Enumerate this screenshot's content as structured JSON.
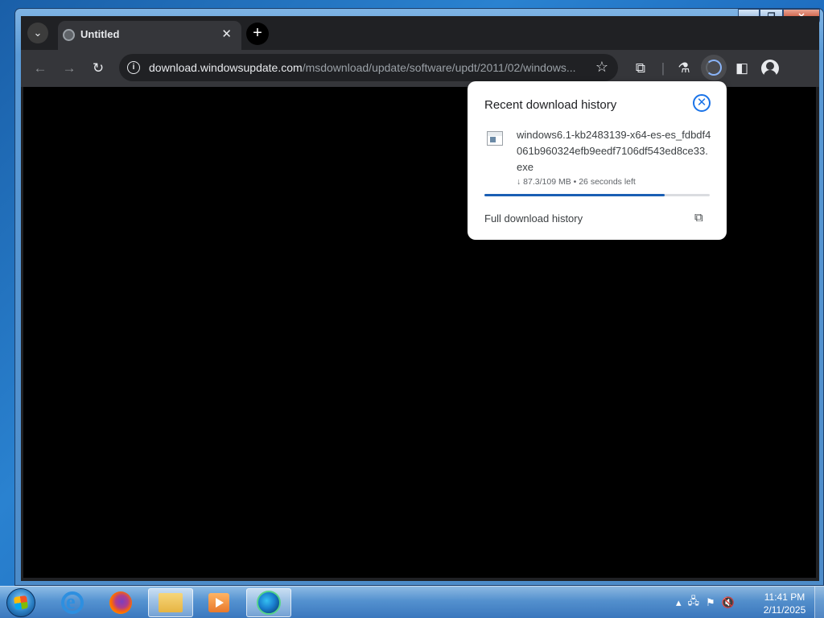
{
  "browser": {
    "tab": {
      "title": "Untitled",
      "close": "✕"
    },
    "new_tab_symbol": "+",
    "omnibox": {
      "url_host": "download.windowsupdate.com",
      "url_path": "/msdownload/update/software/updt/2011/02/windows..."
    }
  },
  "download_popup": {
    "title": "Recent download history",
    "file_name": "windows6.1-kb2483139-x64-es-es_fdbdf4061b960324efb9eedf7106df543ed8ce33.exe",
    "status": "↓ 87.3/109 MB • 26 seconds left",
    "progress_fraction": 0.8,
    "full_history_link": "Full download history"
  },
  "taskbar": {
    "time": "11:41 PM",
    "date": "2/11/2025"
  },
  "colors": {
    "accent": "#1a73e8",
    "progress": "#1a5fb4",
    "chrome_dark": "#202124",
    "toolbar": "#35363a"
  }
}
